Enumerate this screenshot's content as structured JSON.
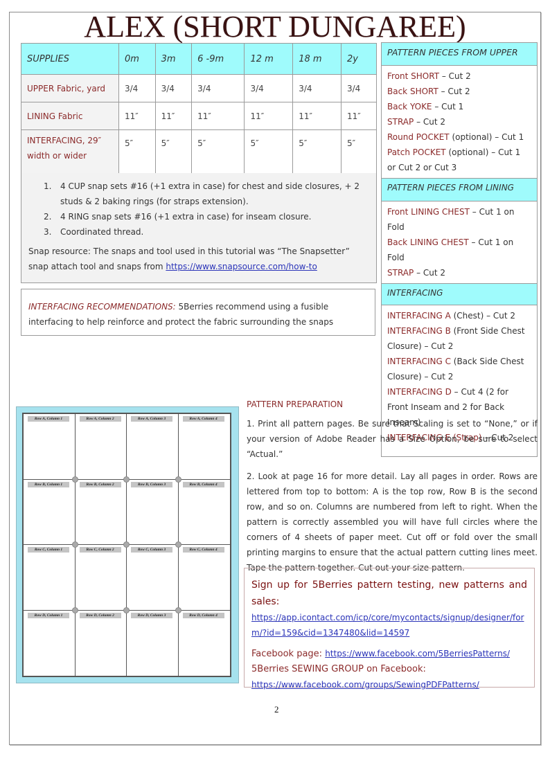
{
  "title": "ALEX (SHORT DUNGAREE)",
  "supplies_table": {
    "headers": [
      "SUPPLIES",
      "0m",
      "3m",
      "6 -9m",
      "12 m",
      "18 m",
      "2y"
    ],
    "rows": [
      {
        "label": "UPPER Fabric, yard",
        "values": [
          "3/4",
          "3/4",
          "3/4",
          "3/4",
          "3/4",
          "3/4"
        ]
      },
      {
        "label": "LINING Fabric",
        "values": [
          "11″",
          "11″",
          "11″",
          "11″",
          "11″",
          "11″"
        ]
      },
      {
        "label": "INTERFACING, 29″ width or wider",
        "values": [
          "5″",
          "5″",
          "5″",
          "5″",
          "5″",
          "5″"
        ]
      }
    ]
  },
  "supplies_notes": {
    "items": [
      {
        "num": "1.",
        "text": "4 CUP snap sets #16 (+1 extra in case) for chest and side closures, + 2 studs & 2 baking rings (for straps extension)."
      },
      {
        "num": "2.",
        "text": "4 RING snap sets #16 (+1 extra in case) for inseam closure."
      },
      {
        "num": "3.",
        "text": "Coordinated thread."
      }
    ],
    "snap_resource_text": "Snap resource: The snaps and tool used in this tutorial was “The Snapsetter” snap attach tool and snaps from ",
    "snap_resource_link": "https://www.snapsource.com/how-to"
  },
  "interfacing_recommendation": {
    "lead": "INTERFACING RECOMMENDATIONS:",
    "text": " 5Berries recommend using a fusible interfacing to help reinforce and protect the fabric surrounding the snaps"
  },
  "pattern_pieces": {
    "upper": {
      "heading": "PATTERN PIECES FROM UPPER",
      "items": [
        {
          "name": "Front SHORT",
          "detail": " – Cut 2"
        },
        {
          "name": "Back SHORT",
          "detail": " – Cut 2"
        },
        {
          "name": "Back YOKE",
          "detail": " – Cut 1"
        },
        {
          "name": "STRAP",
          "detail": " – Cut 2"
        },
        {
          "name": "Round POCKET",
          "detail": " (optional) – Cut 1"
        },
        {
          "name": "Patch POCKET",
          "detail": " (optional) – Cut 1 or Cut 2 or Cut 3"
        }
      ]
    },
    "lining": {
      "heading": "PATTERN PIECES FROM LINING",
      "items": [
        {
          "name": "Front LINING CHEST",
          "detail": " – Cut 1 on Fold"
        },
        {
          "name": "Back LINING CHEST",
          "detail": " – Cut 1 on Fold"
        },
        {
          "name": "STRAP",
          "detail": " – Cut 2"
        }
      ]
    },
    "interfacing": {
      "heading": "INTERFACING",
      "items": [
        {
          "name": "INTERFACING A",
          "detail": " (Chest) – Cut 2"
        },
        {
          "name": "INTERFACING B",
          "detail": " (Front Side Chest Closure) – Cut 2"
        },
        {
          "name": "INTERFACING C",
          "detail": " (Back Side Chest Closure) – Cut 2"
        },
        {
          "name": "INTERFACING D",
          "detail": " – Cut 4 (2 for Front Inseam and 2 for Back Inseam)"
        },
        {
          "name": "INTERFACING E (Strap)",
          "detail": " – Cut 2"
        }
      ]
    }
  },
  "layout_diagram": {
    "rows": [
      "A",
      "B",
      "C",
      "D"
    ],
    "columns": [
      "1",
      "2",
      "3",
      "4"
    ],
    "labels": [
      [
        "Row A, Column 1",
        "Row A, Column 2",
        "Row A, Column 3",
        "Row A, Column 4"
      ],
      [
        "Row B, Column 1",
        "Row B, Column 2",
        "Row B, Column 3",
        "Row B, Column 4"
      ],
      [
        "Row C, Column 1",
        "Row C, Column 2",
        "Row C, Column 3",
        "Row C, Column 4"
      ],
      [
        "Row D, Column 1",
        "Row D, Column 2",
        "Row D, Column 3",
        "Row D, Column 4"
      ]
    ]
  },
  "pattern_preparation": {
    "heading": "PATTERN PREPARATION",
    "step1": "1. Print all pattern pages.  Be sure that Scaling is set to “None,” or if your version of Adobe Reader has a Size Option, be sure to select “Actual.”",
    "step2": "2. Look at page 16 for more detail. Lay all pages in order.  Rows are lettered from top to bottom: A is the top row, Row B is the second row, and so on. Columns are numbered from left to right.  When the pattern is correctly assembled you will have full circles where the corners of 4 sheets of paper meet.  Cut off or fold over the small printing margins to ensure that the actual pattern cutting lines meet.  Tape the pattern together.  Cut out your size pattern."
  },
  "signup_box": {
    "heading": "Sign up for 5Berries pattern testing, new patterns and sales:",
    "signup_link": "https://app.icontact.com/icp/core/mycontacts/signup/designer/form/?id=159&cid=1347480&lid=14597",
    "facebook_label": "Facebook page: ",
    "facebook_link": "https://www.facebook.com/5BerriesPatterns/",
    "group_label": "5Berries SEWING GROUP on Facebook:",
    "group_link": "https://www.facebook.com/groups/SewingPDFPatterns/"
  },
  "page_number": "2",
  "colors": {
    "header_cyan": "#9ffbfc",
    "accent_red": "#8b2a2a",
    "link_blue": "#2a33b8",
    "diagram_bg": "#a6e2ee"
  }
}
